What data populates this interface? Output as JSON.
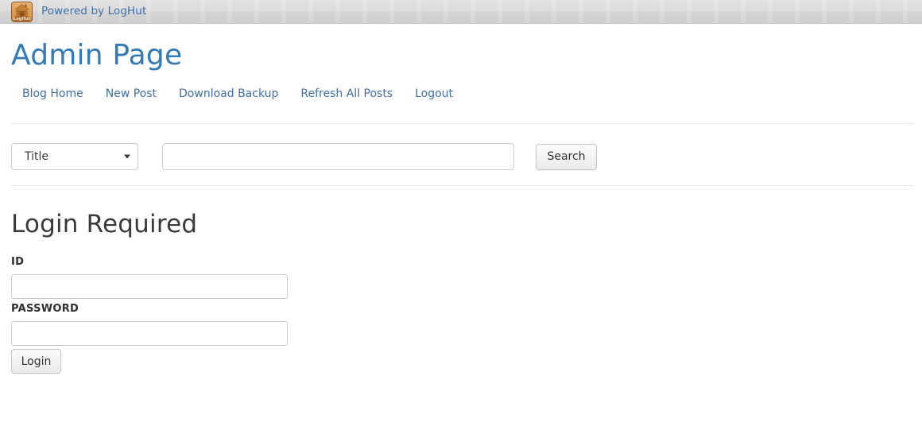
{
  "topbar": {
    "logo_icon": "loghut-logo-icon",
    "logo_alt": "LogHut",
    "powered_link": "Powered by LogHut"
  },
  "header": {
    "title": "Admin Page"
  },
  "nav": {
    "items": [
      {
        "label": "Blog Home"
      },
      {
        "label": "New Post"
      },
      {
        "label": "Download Backup"
      },
      {
        "label": "Refresh All Posts"
      },
      {
        "label": "Logout"
      }
    ]
  },
  "search": {
    "field_select": {
      "selected": "Title",
      "options": [
        "Title"
      ],
      "chevron_icon": "chevron-down-icon"
    },
    "query_value": "",
    "query_placeholder": "",
    "button_label": "Search"
  },
  "login": {
    "heading": "Login Required",
    "id_label": "ID",
    "id_value": "",
    "id_placeholder": "",
    "password_label": "PASSWORD",
    "password_value": "",
    "password_placeholder": "",
    "submit_label": "Login"
  },
  "colors": {
    "link_blue": "#3f6fa8",
    "title_blue": "#337ab7",
    "text_dark": "#3a3a3a",
    "border_gray": "#cccccc",
    "divider_gray": "#e7e7e7",
    "topbar_gray": "#d6d6d6",
    "logo_brown": "#cf8838"
  }
}
